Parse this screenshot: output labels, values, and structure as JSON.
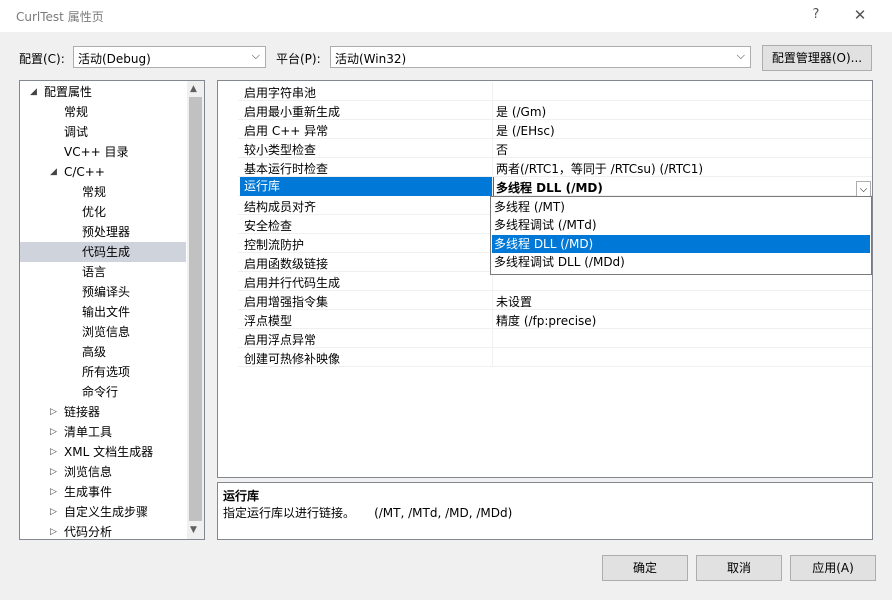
{
  "window": {
    "title": "CurlTest 属性页",
    "help": "?",
    "close": "✕"
  },
  "config": {
    "label": "配置(C):",
    "value": "活动(Debug)",
    "platform_label": "平台(P):",
    "platform_value": "活动(Win32)",
    "manager_button": "配置管理器(O)..."
  },
  "tree": {
    "items": [
      {
        "label": "配置属性",
        "expander": "◢"
      },
      {
        "label": "常规"
      },
      {
        "label": "调试"
      },
      {
        "label": "VC++ 目录"
      },
      {
        "label": "C/C++",
        "expander": "◢"
      },
      {
        "label": "常规"
      },
      {
        "label": "优化"
      },
      {
        "label": "预处理器"
      },
      {
        "label": "代码生成"
      },
      {
        "label": "语言"
      },
      {
        "label": "预编译头"
      },
      {
        "label": "输出文件"
      },
      {
        "label": "浏览信息"
      },
      {
        "label": "高级"
      },
      {
        "label": "所有选项"
      },
      {
        "label": "命令行"
      },
      {
        "label": "链接器",
        "expander": "▷"
      },
      {
        "label": "清单工具",
        "expander": "▷"
      },
      {
        "label": "XML 文档生成器",
        "expander": "▷"
      },
      {
        "label": "浏览信息",
        "expander": "▷"
      },
      {
        "label": "生成事件",
        "expander": "▷"
      },
      {
        "label": "自定义生成步骤",
        "expander": "▷"
      },
      {
        "label": "代码分析",
        "expander": "▷"
      }
    ]
  },
  "grid": {
    "rows": [
      {
        "name": "启用字符串池",
        "value": ""
      },
      {
        "name": "启用最小重新生成",
        "value": "是 (/Gm)"
      },
      {
        "name": "启用 C++ 异常",
        "value": "是 (/EHsc)"
      },
      {
        "name": "较小类型检查",
        "value": "否"
      },
      {
        "name": "基本运行时检查",
        "value": "两者(/RTC1，等同于 /RTCsu) (/RTC1)"
      },
      {
        "name": "运行库",
        "value": "多线程 DLL (/MD)"
      },
      {
        "name": "结构成员对齐",
        "value": ""
      },
      {
        "name": "安全检查",
        "value": ""
      },
      {
        "name": "控制流防护",
        "value": ""
      },
      {
        "name": "启用函数级链接",
        "value": ""
      },
      {
        "name": "启用并行代码生成",
        "value": ""
      },
      {
        "name": "启用增强指令集",
        "value": "未设置"
      },
      {
        "name": "浮点模型",
        "value": "精度 (/fp:precise)"
      },
      {
        "name": "启用浮点异常",
        "value": ""
      },
      {
        "name": "创建可热修补映像",
        "value": ""
      }
    ]
  },
  "dropdown": {
    "options": [
      "多线程 (/MT)",
      "多线程调试 (/MTd)",
      "多线程 DLL (/MD)",
      "多线程调试 DLL (/MDd)"
    ]
  },
  "description": {
    "title": "运行库",
    "text": "指定运行库以进行链接。     (/MT, /MTd, /MD, /MDd)"
  },
  "buttons": {
    "ok": "确定",
    "cancel": "取消",
    "apply": "应用(A)"
  },
  "colors": {
    "selection": "#0078d7",
    "tree_selection": "#cfd3dc"
  }
}
